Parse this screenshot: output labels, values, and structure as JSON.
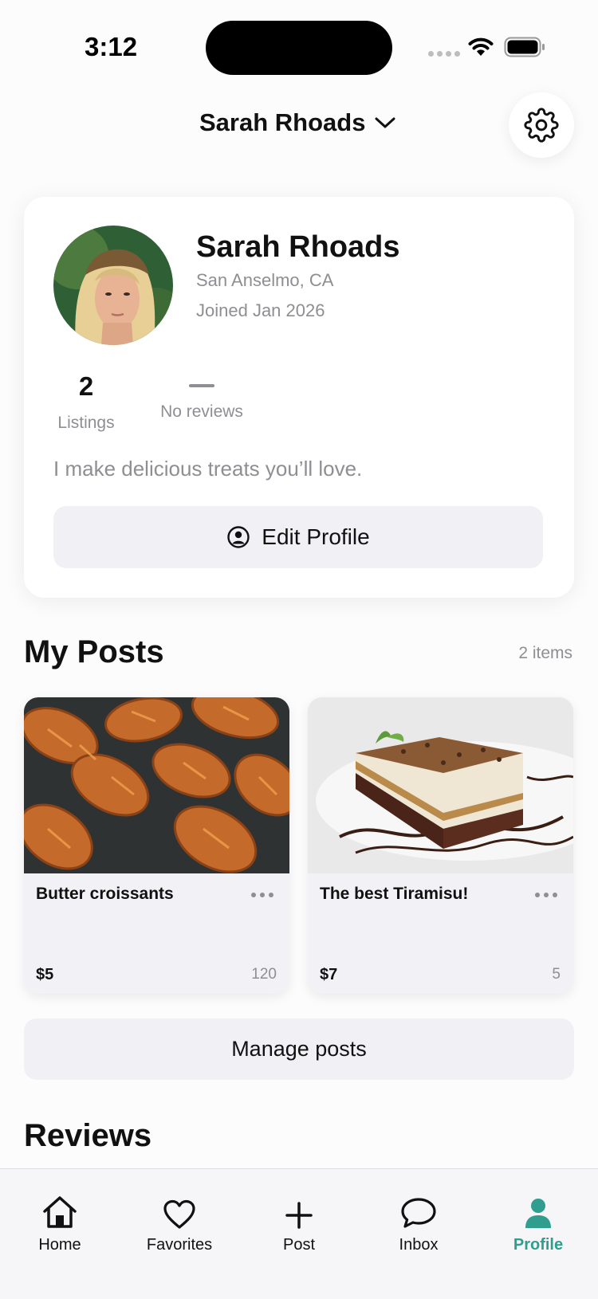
{
  "status_bar": {
    "time": "3:12"
  },
  "header": {
    "title": "Sarah Rhoads"
  },
  "profile": {
    "name": "Sarah Rhoads",
    "location": "San Anselmo, CA",
    "joined": "Joined Jan 2026",
    "stats": {
      "listings_value": "2",
      "listings_label": "Listings",
      "reviews_label": "No reviews"
    },
    "bio": "I make delicious treats you’ll love.",
    "edit_label": "Edit Profile"
  },
  "posts": {
    "title": "My Posts",
    "count": "2 items",
    "items": [
      {
        "title": "Butter croissants",
        "price": "$5",
        "views": "120"
      },
      {
        "title": "The best Tiramisu!",
        "price": "$7",
        "views": "5"
      }
    ],
    "manage_label": "Manage posts"
  },
  "reviews": {
    "title": "Reviews"
  },
  "tabs": [
    {
      "label": "Home",
      "icon": "home-icon"
    },
    {
      "label": "Favorites",
      "icon": "heart-icon"
    },
    {
      "label": "Post",
      "icon": "plus-icon"
    },
    {
      "label": "Inbox",
      "icon": "chat-bubble-icon"
    },
    {
      "label": "Profile",
      "icon": "person-icon"
    }
  ],
  "colors": {
    "accent": "#2f9e8f",
    "secondary_text": "#8e8e93",
    "button_bg": "#f1f1f5"
  }
}
